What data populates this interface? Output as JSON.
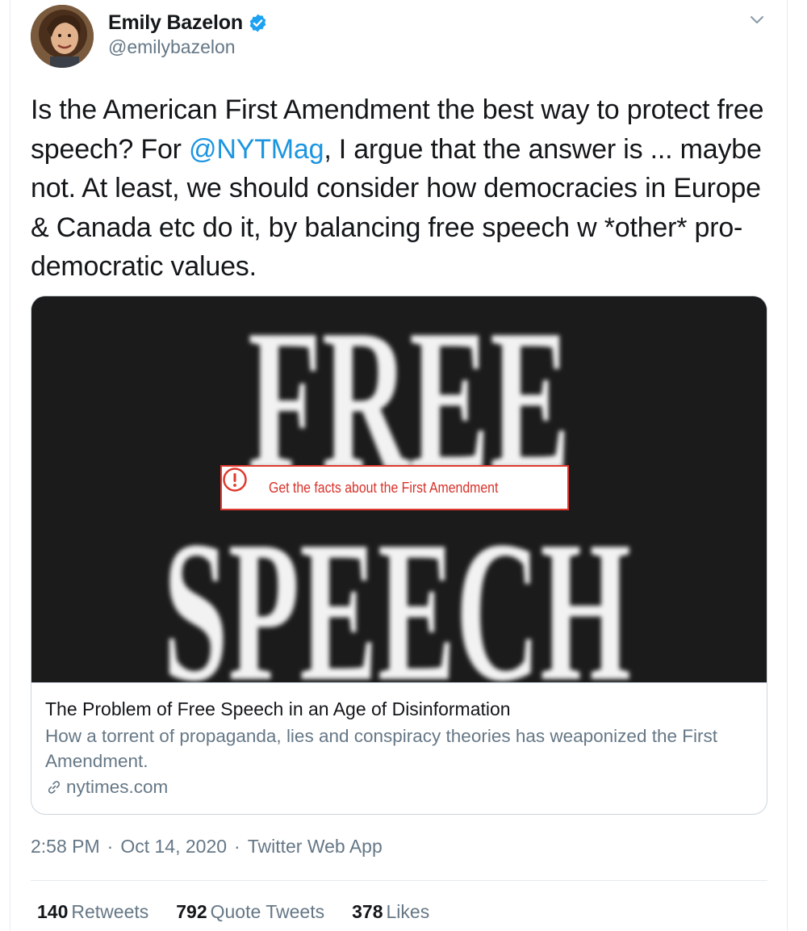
{
  "author": {
    "display_name": "Emily Bazelon",
    "handle": "@emilybazelon",
    "verified": true,
    "avatar_icon": "profile-photo"
  },
  "tweet": {
    "text_before_mention": "Is the American First Amendment the best way to protect free speech? For ",
    "mention": "@NYTMag",
    "text_after_mention": ", I argue that the answer is ... maybe not. At least, we should consider how democracies in Europe & Canada etc do it, by balancing free speech w *other* pro-democratic values."
  },
  "card": {
    "image_text_line1": "FREE",
    "image_text_line2": "SPEECH",
    "notice": "Get the facts about the First Amendment",
    "title": "The Problem of Free Speech in an Age of Disinformation",
    "description": "How a torrent of propaganda, lies and conspiracy theories has weaponized the First Amendment.",
    "domain": "nytimes.com"
  },
  "meta": {
    "time": "2:58 PM",
    "separator": "·",
    "date": "Oct 14, 2020",
    "source": "Twitter Web App"
  },
  "stats": {
    "retweets_count": "140",
    "retweets_label": "Retweets",
    "quotes_count": "792",
    "quotes_label": "Quote Tweets",
    "likes_count": "378",
    "likes_label": "Likes"
  },
  "colors": {
    "link_blue": "#1b95e0",
    "verified_blue": "#1da1f2",
    "notice_red": "#e0392f",
    "muted_text": "#657786"
  }
}
